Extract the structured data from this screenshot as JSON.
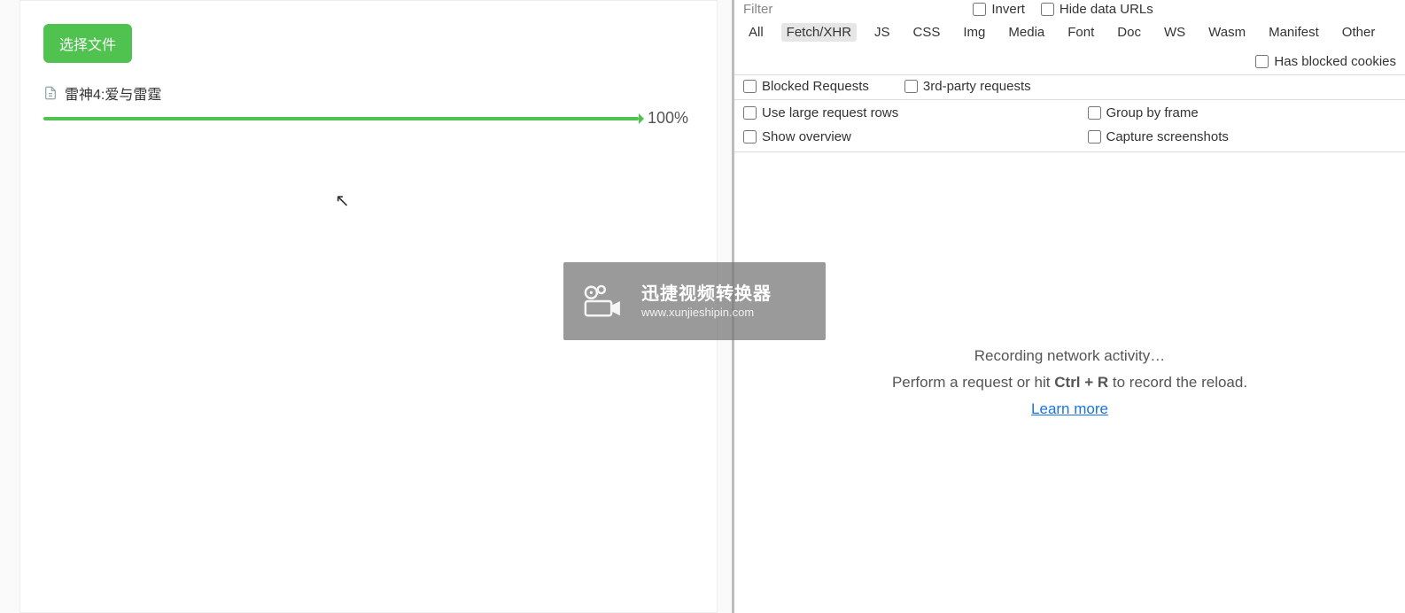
{
  "upload": {
    "choose_label": "选择文件",
    "file_name": "雷神4:爱与雷霆",
    "progress_pct": "100%"
  },
  "watermark": {
    "title": "迅捷视频转换器",
    "url": "www.xunjieshipin.com"
  },
  "devtools": {
    "filter_label": "Filter",
    "filter_value": "",
    "invert_label": "Invert",
    "hide_data_urls_label": "Hide data URLs",
    "types": {
      "all": "All",
      "fetch_xhr": "Fetch/XHR",
      "js": "JS",
      "css": "CSS",
      "img": "Img",
      "media": "Media",
      "font": "Font",
      "doc": "Doc",
      "ws": "WS",
      "wasm": "Wasm",
      "manifest": "Manifest",
      "other": "Other"
    },
    "has_blocked_cookies_label": "Has blocked cookies",
    "blocked_requests_label": "Blocked Requests",
    "third_party_label": "3rd-party requests",
    "use_large_rows_label": "Use large request rows",
    "group_by_frame_label": "Group by frame",
    "show_overview_label": "Show overview",
    "capture_screenshots_label": "Capture screenshots",
    "empty_headline": "Recording network activity…",
    "empty_sub_before": "Perform a request or hit ",
    "empty_sub_key": "Ctrl + R",
    "empty_sub_after": " to record the reload.",
    "learn_more": "Learn more"
  }
}
